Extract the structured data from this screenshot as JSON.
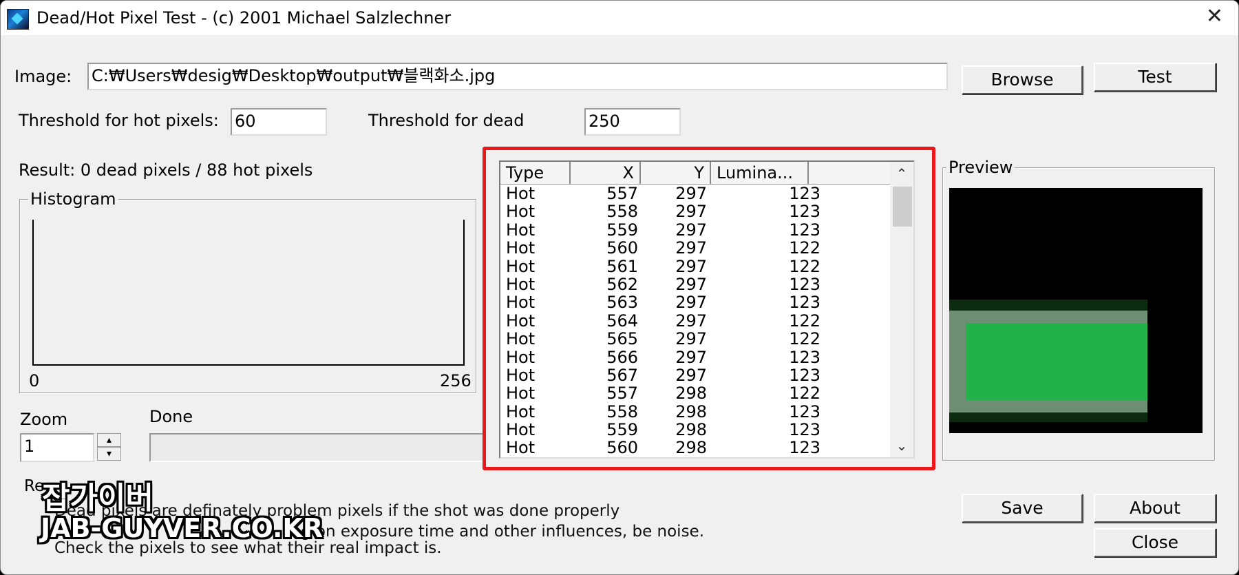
{
  "window": {
    "title": "Dead/Hot Pixel Test - (c) 2001 Michael Salzlechner",
    "close_glyph": "✕"
  },
  "image": {
    "label": "Image:",
    "path": "C:₩Users₩desig₩Desktop₩output₩블랙화소.jpg"
  },
  "buttons": {
    "browse": "Browse",
    "test": "Test",
    "save": "Save",
    "about": "About",
    "close": "Close"
  },
  "thresholds": {
    "hot_label": "Threshold for hot pixels:",
    "hot_value": "60",
    "dead_label": "Threshold for dead",
    "dead_value": "250"
  },
  "result": {
    "text": "Result:  0 dead pixels / 88 hot pixels"
  },
  "histogram": {
    "title": "Histogram",
    "min_label": "0",
    "max_label": "256"
  },
  "zoom": {
    "label": "Zoom",
    "value": "1"
  },
  "status": {
    "label": "Done"
  },
  "list": {
    "columns": [
      "Type",
      "X",
      "Y",
      "Lumina..."
    ],
    "rows": [
      [
        "Hot",
        "557",
        "297",
        "123"
      ],
      [
        "Hot",
        "558",
        "297",
        "123"
      ],
      [
        "Hot",
        "559",
        "297",
        "123"
      ],
      [
        "Hot",
        "560",
        "297",
        "122"
      ],
      [
        "Hot",
        "561",
        "297",
        "122"
      ],
      [
        "Hot",
        "562",
        "297",
        "123"
      ],
      [
        "Hot",
        "563",
        "297",
        "123"
      ],
      [
        "Hot",
        "564",
        "297",
        "122"
      ],
      [
        "Hot",
        "565",
        "297",
        "122"
      ],
      [
        "Hot",
        "566",
        "297",
        "123"
      ],
      [
        "Hot",
        "567",
        "297",
        "123"
      ],
      [
        "Hot",
        "557",
        "298",
        "122"
      ],
      [
        "Hot",
        "558",
        "298",
        "123"
      ],
      [
        "Hot",
        "559",
        "298",
        "123"
      ],
      [
        "Hot",
        "560",
        "298",
        "123"
      ]
    ],
    "scroll_up": "^",
    "scroll_down": "v"
  },
  "preview": {
    "title": "Preview"
  },
  "remarks": {
    "label": "Re",
    "line1": "Dead pixels are definately problem pixels if the shot was done properly",
    "line2": "g on exposure time and other influences, be noise.",
    "line3": "Check the pixels to see what their real impact is."
  },
  "watermark": {
    "korean": "잡가이버",
    "site": "JAB-GUYVER.CO.KR"
  },
  "colors": {
    "highlight_frame": "#e8191c",
    "preview_green": "#23b24a"
  }
}
